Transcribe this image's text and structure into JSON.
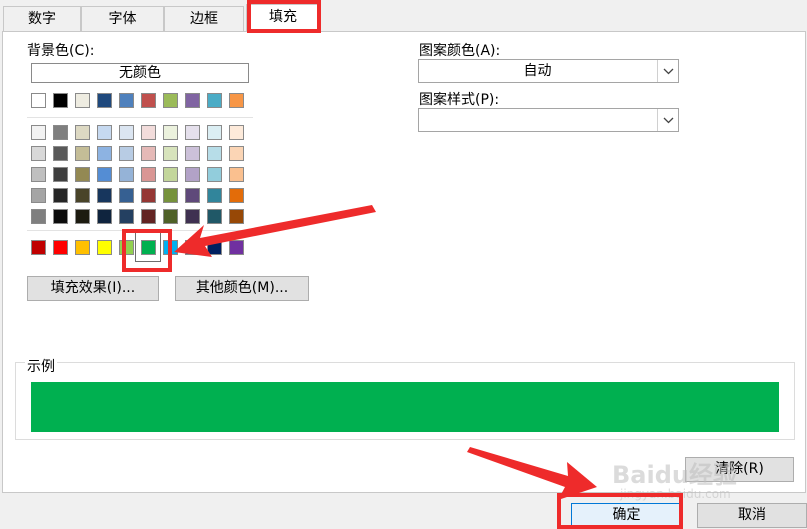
{
  "tabs": [
    "数字",
    "字体",
    "边框",
    "填充"
  ],
  "background": {
    "label": "背景色(C):",
    "no_color": "无颜色",
    "theme_row": [
      "#ffffff",
      "#000000",
      "#eeece1",
      "#1f497d",
      "#4f81bd",
      "#c0504d",
      "#9bbb59",
      "#8064a2",
      "#4bacc6",
      "#f79646"
    ],
    "tint_rows": [
      [
        "#f2f2f2",
        "#7f7f7f",
        "#ddd9c3",
        "#c6d9f0",
        "#dbe5f1",
        "#f2dcdb",
        "#ebf1dd",
        "#e5e0ec",
        "#dbeef3",
        "#fdeada"
      ],
      [
        "#d8d8d8",
        "#595959",
        "#c4bd97",
        "#8db3e2",
        "#b8cce4",
        "#e5b9b7",
        "#d7e3bc",
        "#ccc1d9",
        "#b7dde8",
        "#fbd5b5"
      ],
      [
        "#bfbfbf",
        "#3f3f3f",
        "#938953",
        "#548dd4",
        "#95b3d7",
        "#d99694",
        "#c3d69b",
        "#b2a2c7",
        "#92cddc",
        "#fac08f"
      ],
      [
        "#a5a5a5",
        "#262626",
        "#494429",
        "#17365d",
        "#366092",
        "#953734",
        "#76923c",
        "#5f497a",
        "#31859b",
        "#e36c09"
      ],
      [
        "#7f7f7f",
        "#0c0c0c",
        "#1d1b10",
        "#0f243e",
        "#244061",
        "#632423",
        "#4f6128",
        "#3f3151",
        "#205867",
        "#974806"
      ]
    ],
    "standard_row": [
      "#c00000",
      "#ff0000",
      "#ffc000",
      "#ffff00",
      "#92d050",
      "#00b050",
      "#00b0f0",
      "#0070c0",
      "#002060",
      "#7030a0"
    ],
    "selected_color": "#00b050"
  },
  "buttons": {
    "fill_effects": "填充效果(I)...",
    "more_colors": "其他颜色(M)...",
    "clear": "清除(R)",
    "ok": "确定",
    "cancel": "取消"
  },
  "pattern": {
    "color_label": "图案颜色(A):",
    "color_value": "自动",
    "style_label": "图案样式(P):",
    "style_value": ""
  },
  "sample": {
    "label": "示例",
    "color": "#00b050"
  },
  "watermark": {
    "logo": "Baidu经验",
    "sub": "jingyan.baidu.com"
  },
  "annotation_color": "#ee2b2b"
}
